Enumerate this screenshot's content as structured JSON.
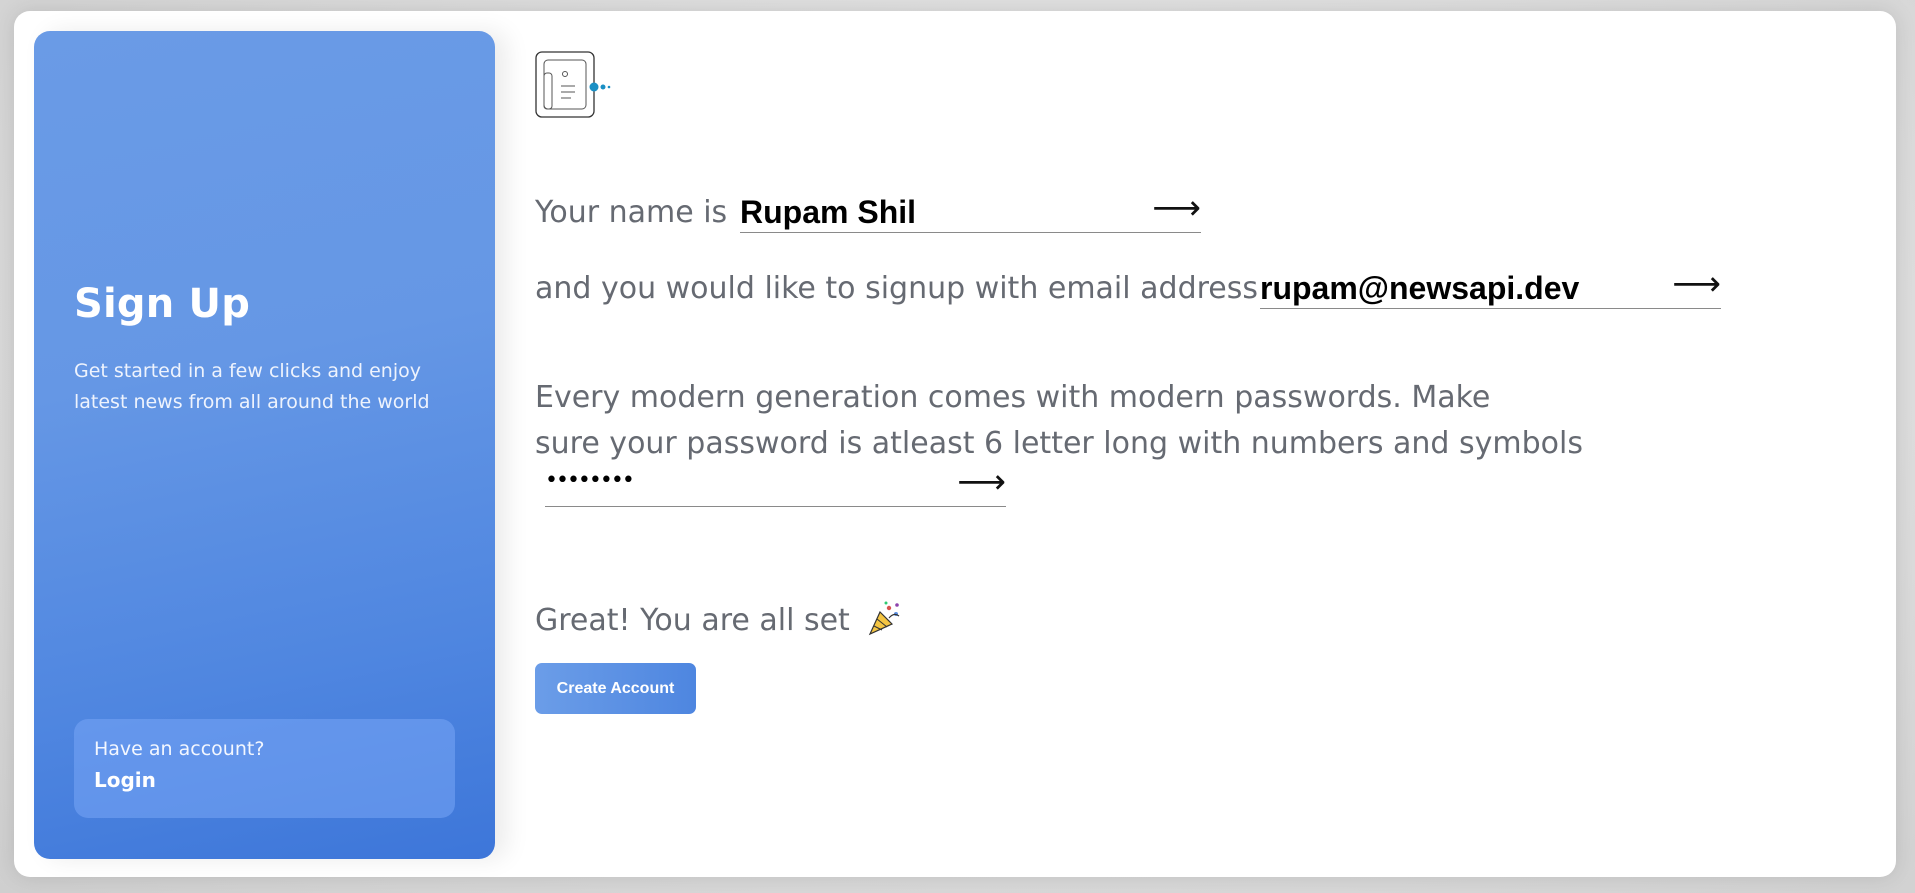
{
  "sidebar": {
    "title": "Sign Up",
    "subtitle": "Get started in a few clicks and enjoy latest news from all around the world",
    "have_account": "Have an account?",
    "login_label": "Login"
  },
  "form": {
    "name_prompt": "Your name is",
    "name_value": "Rupam Shil",
    "email_prompt": "and you would like to signup with email address",
    "email_value": "rupam@newsapi.dev",
    "password_prompt_line1": "Every modern generation comes with modern passwords. Make",
    "password_prompt_line2": "sure your password is atleast 6 letter long with numbers and symbols",
    "password_masked": "••••••••",
    "arrow": "⟶",
    "done_text": "Great! You are all set",
    "create_label": "Create Account"
  },
  "icons": {
    "logo": "newspaper-icon",
    "submit": "arrow-right-icon",
    "celebration": "party-popper-icon"
  },
  "colors": {
    "accent": "#5b8fe3",
    "text": "#666a72"
  }
}
